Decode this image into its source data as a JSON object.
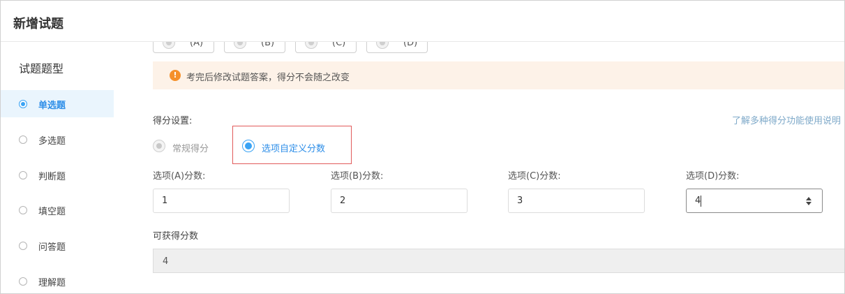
{
  "header": {
    "title": "新增试题"
  },
  "sidebar": {
    "title": "试题题型",
    "items": [
      {
        "label": "单选题",
        "selected": true
      },
      {
        "label": "多选题",
        "selected": false
      },
      {
        "label": "判断题",
        "selected": false
      },
      {
        "label": "填空题",
        "selected": false
      },
      {
        "label": "问答题",
        "selected": false
      },
      {
        "label": "理解题",
        "selected": false
      }
    ]
  },
  "answer_options": [
    {
      "label": "(A)"
    },
    {
      "label": "(B)"
    },
    {
      "label": "(C)"
    },
    {
      "label": "(D)"
    }
  ],
  "notice": {
    "icon": "exclamation-icon",
    "text": "考完后修改试题答案，得分不会随之改变",
    "color": "#f5902a"
  },
  "scoring": {
    "label": "得分设置:",
    "help_link": "了解多种得分功能使用说明",
    "modes": [
      {
        "label": "常规得分",
        "selected": false,
        "disabled": true
      },
      {
        "label": "选项自定义分数",
        "selected": true
      }
    ],
    "fields": [
      {
        "label": "选项(A)分数:",
        "value": "1"
      },
      {
        "label": "选项(B)分数:",
        "value": "2"
      },
      {
        "label": "选项(C)分数:",
        "value": "3"
      },
      {
        "label": "选项(D)分数:",
        "value": "4"
      }
    ],
    "total_label": "可获得分数",
    "total_value": "4"
  },
  "colors": {
    "accent": "#3aa3f4",
    "highlight_border": "#e15a5a"
  }
}
